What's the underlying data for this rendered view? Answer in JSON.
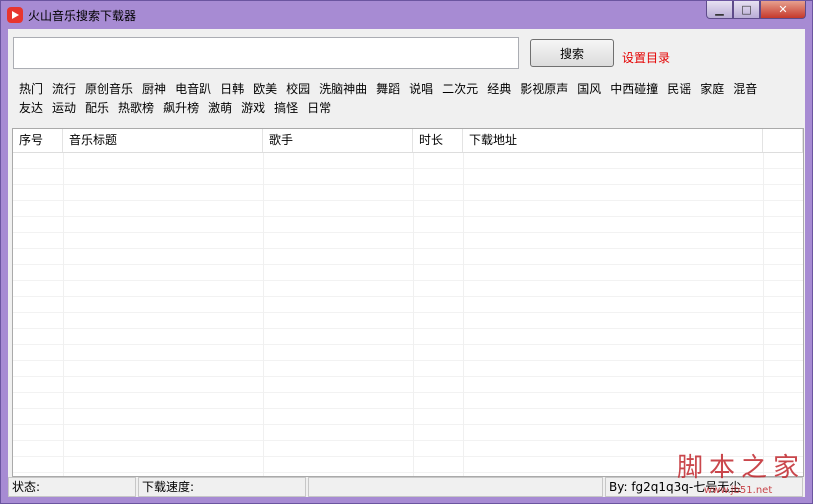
{
  "window": {
    "title": "火山音乐搜索下载器",
    "minimize_glyph": "▁",
    "maximize_glyph": "□",
    "close_glyph": "✕"
  },
  "search": {
    "value": "",
    "placeholder": "",
    "button_label": "搜索",
    "set_dir_label": "设置目录"
  },
  "categories": {
    "row1": [
      "热门",
      "流行",
      "原创音乐",
      "厨神",
      "电音趴",
      "日韩",
      "欧美",
      "校园",
      "洗脑神曲",
      "舞蹈",
      "说唱",
      "二次元",
      "经典",
      "影视原声",
      "国风",
      "中西碰撞",
      "民谣",
      "家庭",
      "混音"
    ],
    "row2": [
      "友达",
      "运动",
      "配乐",
      "热歌榜",
      "飙升榜",
      "激萌",
      "游戏",
      "搞怪",
      "日常"
    ]
  },
  "table": {
    "columns": [
      "序号",
      "音乐标题",
      "歌手",
      "时长",
      "下载地址",
      ""
    ]
  },
  "status": {
    "state_label": "状态:",
    "speed_label": "下载速度:",
    "author": "By: fg2q1q3q-七号无尘"
  },
  "watermark": {
    "text": "脚本之家",
    "url": "www.jb51.net"
  },
  "colors": {
    "frame": "#a78bd3",
    "accent_red": "#e40000",
    "close_red": "#c5392c"
  }
}
